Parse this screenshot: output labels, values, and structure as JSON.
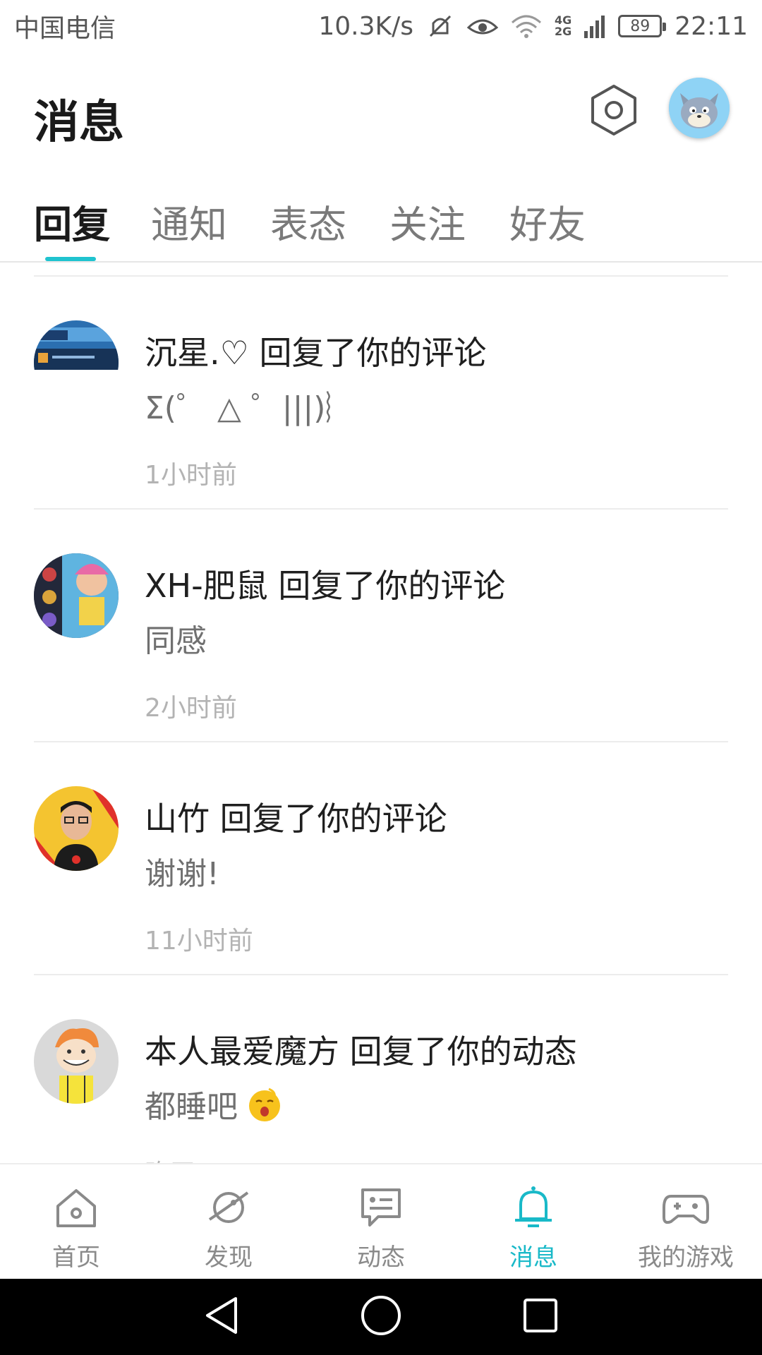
{
  "status_bar": {
    "carrier": "中国电信",
    "net_speed": "10.3K/s",
    "net_types": [
      "4G",
      "2G"
    ],
    "battery": "89",
    "time": "22:11"
  },
  "header": {
    "title": "消息",
    "settings_icon": "hexagon-settings-icon",
    "avatar_icon": "cartoon-cat-avatar"
  },
  "tabs": [
    {
      "label": "回复",
      "active": true
    },
    {
      "label": "通知",
      "active": false
    },
    {
      "label": "表态",
      "active": false
    },
    {
      "label": "关注",
      "active": false
    },
    {
      "label": "好友",
      "active": false
    }
  ],
  "messages": [
    {
      "title": "沉星.♡ 回复了你的评论",
      "content": "Σ(゜ △ ゜|||)︴",
      "time": "1小时前"
    },
    {
      "title": "XH-肥鼠 回复了你的评论",
      "content": "同感",
      "time": "2小时前"
    },
    {
      "title": "山竹 回复了你的评论",
      "content": "谢谢!",
      "time": "11小时前"
    },
    {
      "title": "本人最爱魔方 回复了你的动态",
      "content": "都睡吧",
      "content_emoji": "sleepy-face-emoji",
      "time": "昨天"
    }
  ],
  "bottom_nav": [
    {
      "label": "首页",
      "icon": "home-icon",
      "active": false
    },
    {
      "label": "发现",
      "icon": "planet-icon",
      "active": false
    },
    {
      "label": "动态",
      "icon": "chat-card-icon",
      "active": false
    },
    {
      "label": "消息",
      "icon": "bell-icon",
      "active": true
    },
    {
      "label": "我的游戏",
      "icon": "gamepad-icon",
      "active": false
    }
  ],
  "colors": {
    "accent": "#19b9c8",
    "text_primary": "#1f1f1f",
    "text_secondary": "#707070",
    "text_muted": "#b3b3b3"
  }
}
